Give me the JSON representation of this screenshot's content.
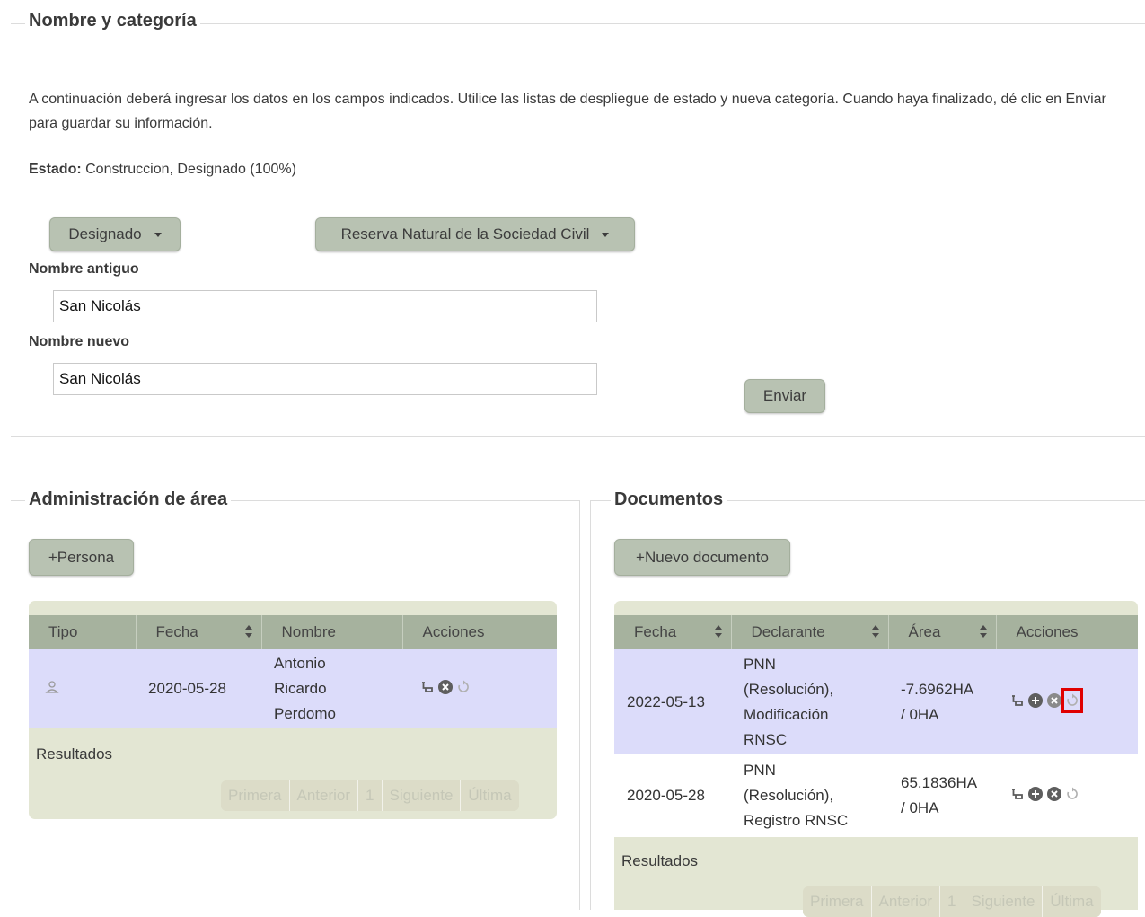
{
  "section_top": {
    "legend": "Nombre y categoría",
    "instructions": "A continuación deberá ingresar los datos en los campos indicados. Utilice las listas de despliegue de estado y nueva categoría. Cuando haya finalizado, dé clic en Enviar para guardar su información.",
    "estado_label": "Estado:",
    "estado_value": "Construccion, Designado (100%)",
    "status_select": "Designado",
    "category_select": "Reserva Natural de la Sociedad Civil",
    "old_name_label": "Nombre antiguo",
    "old_name_value": "San Nicolás",
    "new_name_label": "Nombre nuevo",
    "new_name_value": "San Nicolás",
    "submit_label": "Enviar"
  },
  "area_admin": {
    "legend": "Administración de área",
    "add_button": "+Persona",
    "columns": [
      "Tipo",
      "Fecha",
      "Nombre",
      "Acciones"
    ],
    "rows": [
      {
        "tipo_icon": "person-icon",
        "fecha": "2020-05-28",
        "nombre": [
          "Antonio",
          "Ricardo",
          "Perdomo"
        ]
      }
    ],
    "results_label": "Resultados",
    "pager": [
      "Primera",
      "Anterior",
      "1",
      "Siguiente",
      "Última"
    ]
  },
  "documents": {
    "legend": "Documentos",
    "add_button": "+Nuevo documento",
    "columns": [
      "Fecha",
      "Declarante",
      "Área",
      "Acciones"
    ],
    "rows": [
      {
        "fecha": "2022-05-13",
        "declarante": [
          "PNN",
          "(Resolución),",
          "Modificación",
          "RNSC"
        ],
        "area": [
          "-7.6962HA",
          "/ 0HA"
        ]
      },
      {
        "fecha": "2020-05-28",
        "declarante": [
          "PNN",
          "(Resolución),",
          "Registro RNSC"
        ],
        "area": [
          "65.1836HA",
          "/ 0HA"
        ]
      }
    ],
    "results_label": "Resultados",
    "pager": [
      "Primera",
      "Anterior",
      "1",
      "Siguiente",
      "Última"
    ]
  },
  "icons": {
    "actions": [
      "edit-icon",
      "add-icon",
      "delete-icon",
      "refresh-icon"
    ],
    "colors": {
      "button": "#b8c2b2",
      "header": "#a6b29e",
      "grid_bg": "#e3e6d3",
      "selected_row": "#dcdcfa",
      "highlight": "#e00000"
    }
  }
}
